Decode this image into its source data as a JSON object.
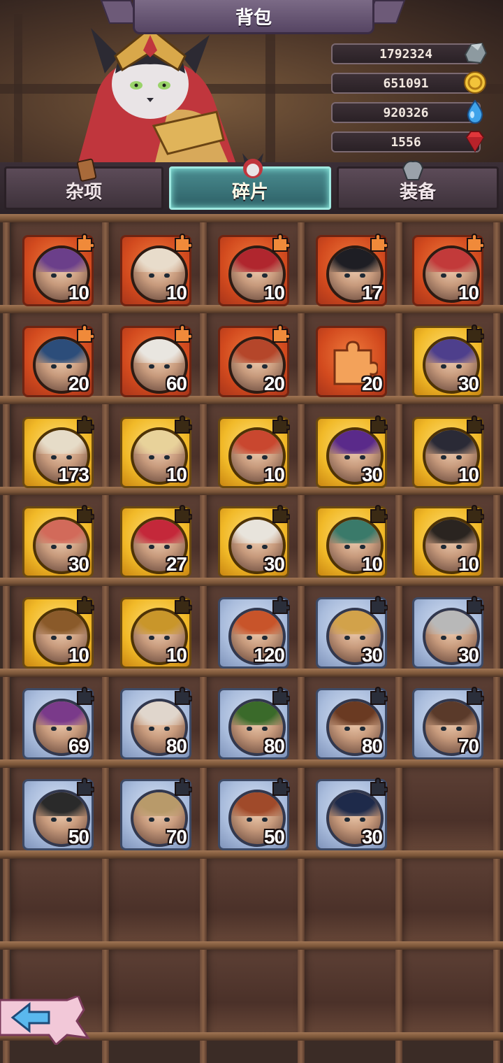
{
  "header": {
    "title": "背包"
  },
  "resources": [
    {
      "value": "1792324",
      "icon": "stone-icon"
    },
    {
      "value": "651091",
      "icon": "gold-coin-icon"
    },
    {
      "value": "920326",
      "icon": "water-drop-icon"
    },
    {
      "value": "1556",
      "icon": "ruby-gem-icon"
    }
  ],
  "tabs": [
    {
      "label": "杂项",
      "active": false
    },
    {
      "label": "碎片",
      "active": true
    },
    {
      "label": "装备",
      "active": false
    }
  ],
  "items": [
    {
      "rarity": "orange",
      "count": "10",
      "hair": "#6b3f8a"
    },
    {
      "rarity": "orange",
      "count": "10",
      "hair": "#e8dccb"
    },
    {
      "rarity": "orange",
      "count": "10",
      "hair": "#b0262e"
    },
    {
      "rarity": "orange",
      "count": "17",
      "hair": "#1e1e24"
    },
    {
      "rarity": "orange",
      "count": "10",
      "hair": "#c23a3a"
    },
    {
      "rarity": "orange",
      "count": "20",
      "hair": "#2c4d7a"
    },
    {
      "rarity": "orange",
      "count": "60",
      "hair": "#e9e6e0"
    },
    {
      "rarity": "orange",
      "count": "20",
      "hair": "#b5462a"
    },
    {
      "rarity": "orange",
      "count": "20",
      "hair": "puzzle"
    },
    {
      "rarity": "gold",
      "count": "30",
      "hair": "#4e3f8c"
    },
    {
      "rarity": "gold",
      "count": "173",
      "hair": "#e6dcc8"
    },
    {
      "rarity": "gold",
      "count": "10",
      "hair": "#e8d29a"
    },
    {
      "rarity": "gold",
      "count": "10",
      "hair": "#c9472f"
    },
    {
      "rarity": "gold",
      "count": "30",
      "hair": "#5a2a8a"
    },
    {
      "rarity": "gold",
      "count": "10",
      "hair": "#2a2a36"
    },
    {
      "rarity": "gold",
      "count": "30",
      "hair": "#d26a5a"
    },
    {
      "rarity": "gold",
      "count": "27",
      "hair": "#c4283a"
    },
    {
      "rarity": "gold",
      "count": "30",
      "hair": "#e8e4dc"
    },
    {
      "rarity": "gold",
      "count": "10",
      "hair": "#3a7a6a"
    },
    {
      "rarity": "gold",
      "count": "10",
      "hair": "#2a2420"
    },
    {
      "rarity": "gold",
      "count": "10",
      "hair": "#8a5a2a"
    },
    {
      "rarity": "gold",
      "count": "10",
      "hair": "#c9962a"
    },
    {
      "rarity": "blue",
      "count": "120",
      "hair": "#c8542a"
    },
    {
      "rarity": "blue",
      "count": "30",
      "hair": "#d2a24a"
    },
    {
      "rarity": "blue",
      "count": "30",
      "hair": "#b8b8b8"
    },
    {
      "rarity": "blue",
      "count": "69",
      "hair": "#7a3a8a"
    },
    {
      "rarity": "blue",
      "count": "80",
      "hair": "#e0d6cc"
    },
    {
      "rarity": "blue",
      "count": "80",
      "hair": "#3a6a2a"
    },
    {
      "rarity": "blue",
      "count": "80",
      "hair": "#6a3a22"
    },
    {
      "rarity": "blue",
      "count": "70",
      "hair": "#5a3a2a"
    },
    {
      "rarity": "blue",
      "count": "50",
      "hair": "#2a2a2a"
    },
    {
      "rarity": "blue",
      "count": "70",
      "hair": "#b89a6a"
    },
    {
      "rarity": "blue",
      "count": "50",
      "hair": "#a04a2a"
    },
    {
      "rarity": "blue",
      "count": "30",
      "hair": "#1e2a4a"
    }
  ],
  "colors": {
    "active_tab": "#4a8c90",
    "orange_frame": "#d24a1e",
    "gold_frame": "#f1b928",
    "blue_frame": "#a9bcdc"
  },
  "back_button": {
    "icon": "back-arrow-icon"
  }
}
